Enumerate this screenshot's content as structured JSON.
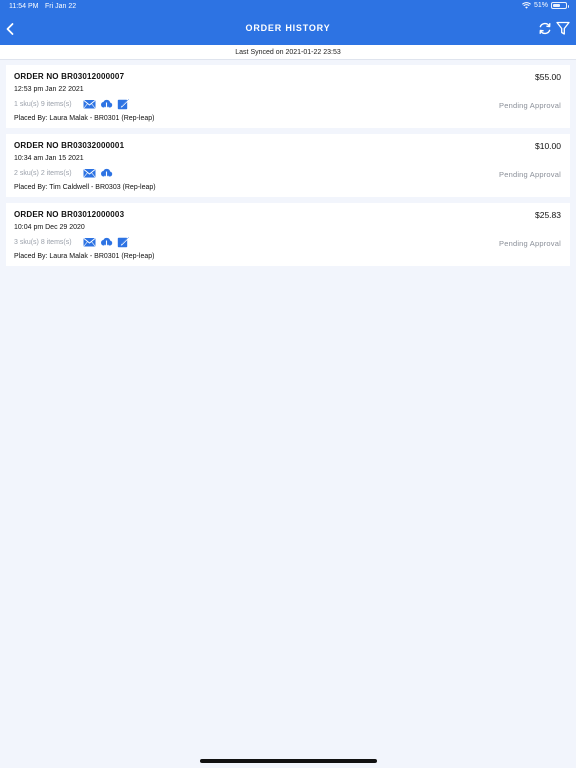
{
  "status_bar": {
    "time": "11:54 PM",
    "date": "Fri Jan 22",
    "battery": "51%",
    "battery_level": 0.51
  },
  "header": {
    "title": "ORDER HISTORY",
    "back_icon": "chevron-left-icon",
    "sync_icon": "refresh-icon",
    "filter_icon": "filter-icon"
  },
  "sync": {
    "text": "Last Synced on 2021-01-22 23:53"
  },
  "orders": [
    {
      "order_no": "ORDER NO BR03012000007",
      "amount": "$55.00",
      "date": "12:53 pm Jan 22 2021",
      "items": "1 sku(s) 9 items(s)",
      "status": "Pending Approval",
      "placed_by": "Placed By: Laura Malak - BR0301 (Rep-leap)",
      "icons": [
        "email-icon",
        "cloud-download-icon",
        "edit-icon"
      ]
    },
    {
      "order_no": "ORDER NO BR03032000001",
      "amount": "$10.00",
      "date": "10:34 am Jan 15 2021",
      "items": "2 sku(s) 2 items(s)",
      "status": "Pending Approval",
      "placed_by": "Placed By: Tim Caldwell - BR0303 (Rep-leap)",
      "icons": [
        "email-icon",
        "cloud-download-icon"
      ]
    },
    {
      "order_no": "ORDER NO BR03012000003",
      "amount": "$25.83",
      "date": "10:04 pm Dec 29 2020",
      "items": "3 sku(s) 8 items(s)",
      "status": "Pending Approval",
      "placed_by": "Placed By: Laura Malak - BR0301 (Rep-leap)",
      "icons": [
        "email-icon",
        "cloud-download-icon",
        "edit-icon"
      ]
    }
  ],
  "colors": {
    "header_bg": "#2d73e3",
    "icon_blue": "#2d73e3",
    "page_bg": "#f2f5fc",
    "status_grey": "#8a8f98"
  }
}
